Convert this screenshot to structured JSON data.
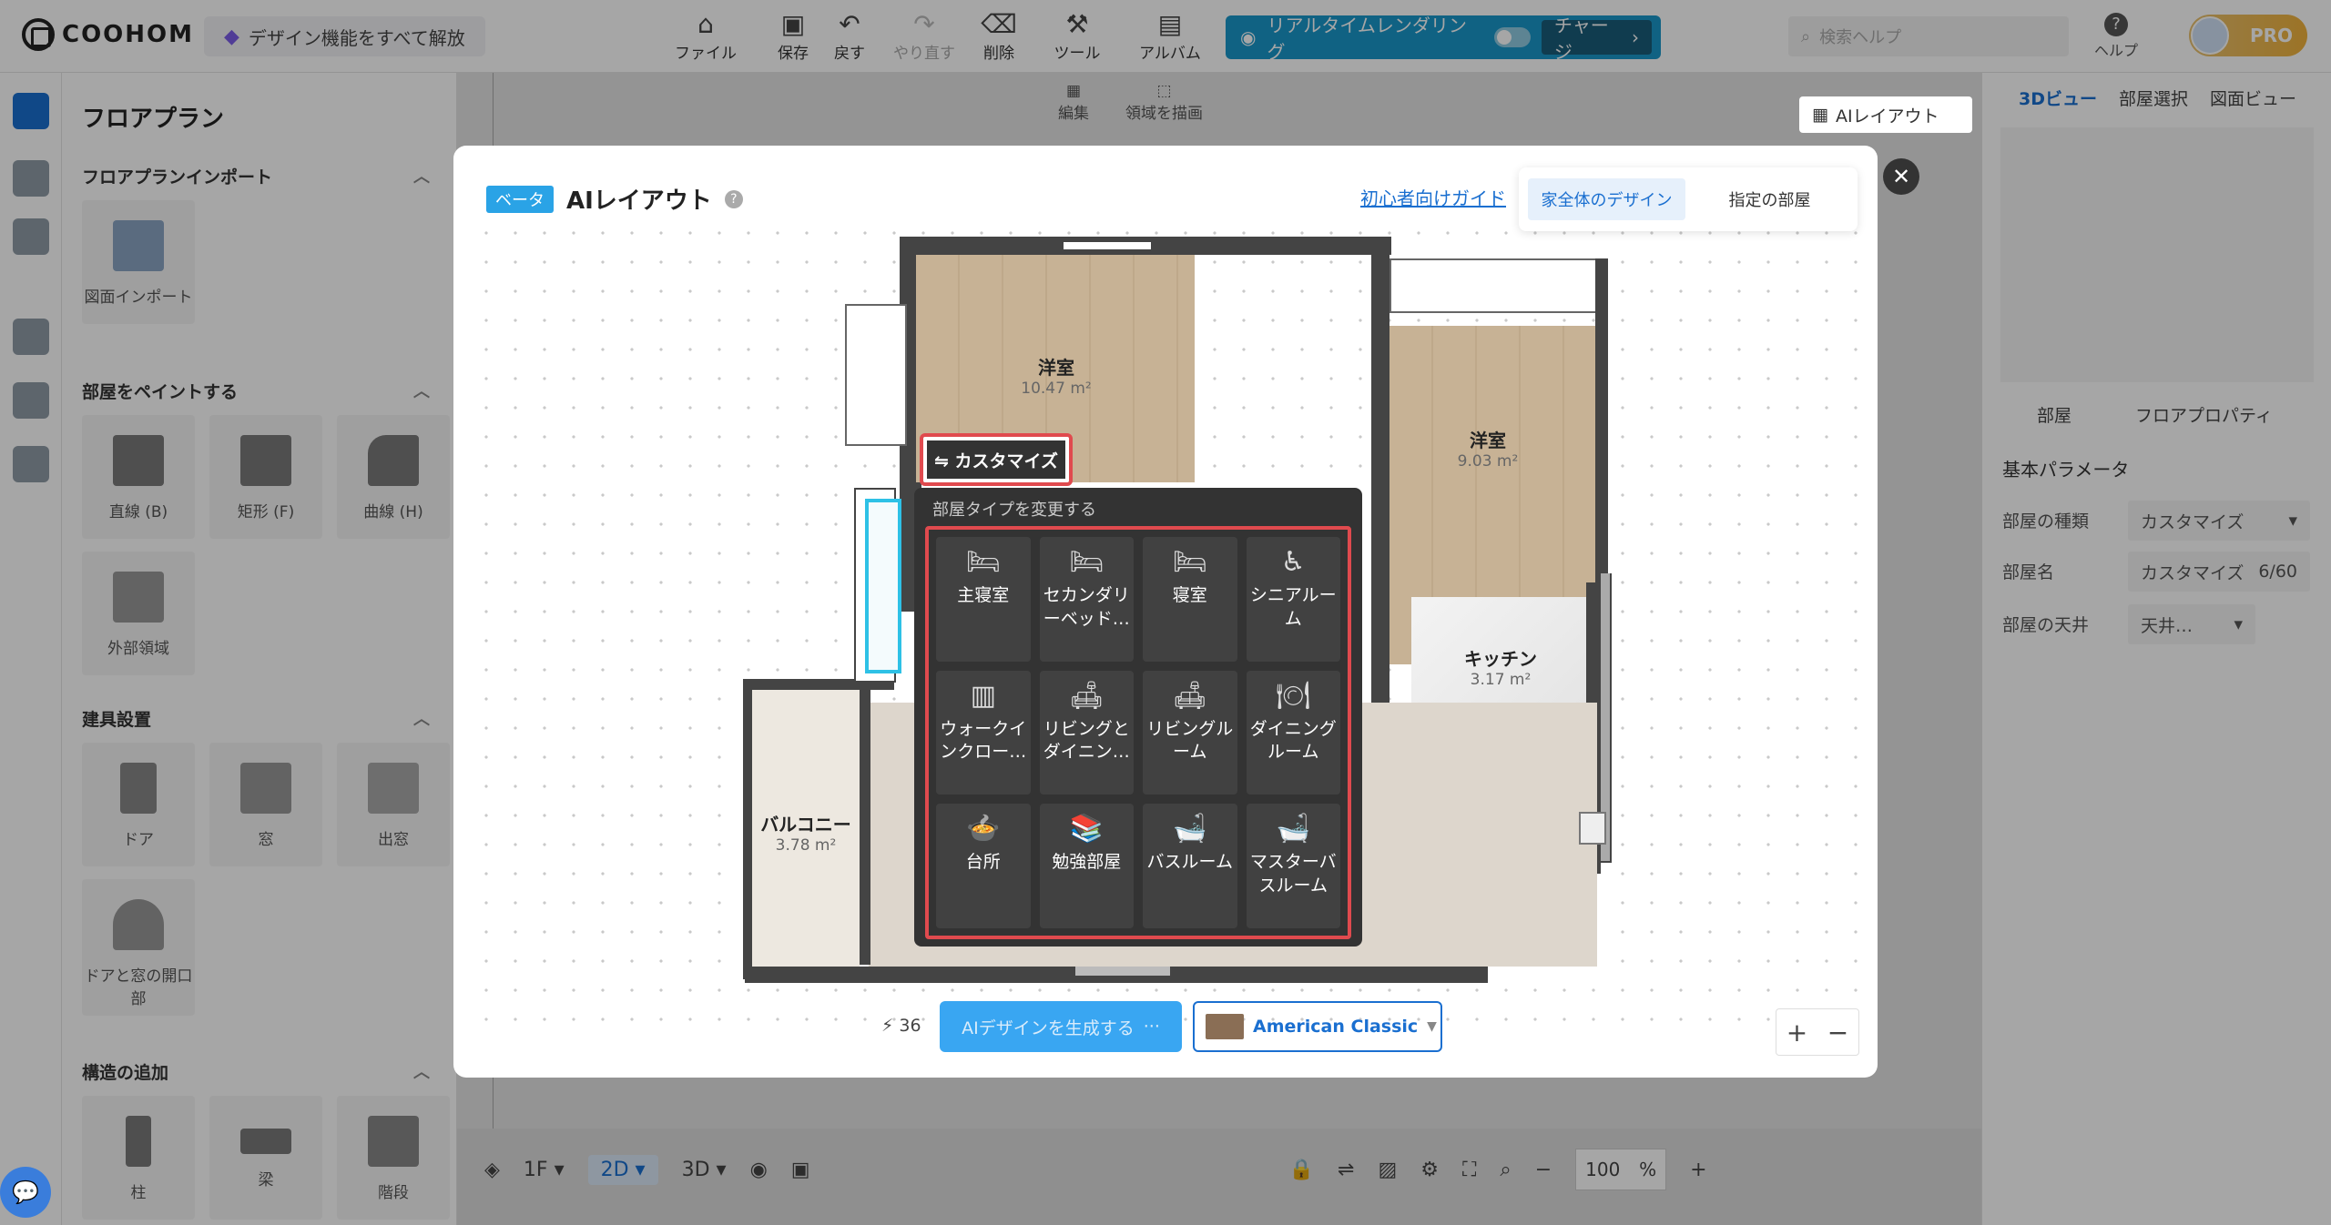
{
  "app": {
    "logo": "COOHOM",
    "unlock": "デザイン機能をすべて解放"
  },
  "toolbar": [
    {
      "icon": "⌂",
      "label": "ファイル",
      "dim": false
    },
    {
      "icon": "▣",
      "label": "保存",
      "dim": false
    },
    {
      "icon": "↶",
      "label": "戻す",
      "dim": false
    },
    {
      "icon": "↷",
      "label": "やり直す",
      "dim": true
    },
    {
      "icon": "⌫",
      "label": "削除",
      "dim": false
    },
    {
      "icon": "⚒",
      "label": "ツール",
      "dim": false
    },
    {
      "icon": "▤",
      "label": "アルバム",
      "dim": false
    }
  ],
  "render": {
    "label": "リアルタイムレンダリング",
    "charge": "チャージ"
  },
  "search": {
    "placeholder": "検索ヘルプ"
  },
  "help": {
    "label": "ヘルプ"
  },
  "pro": "PRO",
  "left": {
    "title": "フロアプラン",
    "sections": {
      "import": "フロアプランインポート",
      "paint": "部屋をペイントする",
      "fixtures": "建具設置",
      "structure": "構造の追加"
    },
    "import_tile": "図面インポート",
    "paint_tiles": [
      "直線 (B)",
      "矩形 (F)",
      "曲線 (H)",
      "外部領域"
    ],
    "fixture_tiles": [
      "ドア",
      "窓",
      "出窓",
      "ドアと窓の開口部"
    ],
    "structure_tiles": [
      "柱",
      "梁",
      "階段"
    ]
  },
  "canvas": {
    "subtools": [
      "編集",
      "領域を描画"
    ],
    "floor": "1F",
    "view2d": "2D",
    "view3d": "3D",
    "zoom": "100",
    "unit": "%"
  },
  "right": {
    "tabs": [
      "3Dビュー",
      "部屋選択",
      "図面ビュー"
    ],
    "ai_button": "AIレイアウト",
    "prop_tabs": [
      "部屋",
      "フロアプロパティ"
    ],
    "basic": "基本パラメータ",
    "fields": [
      {
        "label": "部屋の種類",
        "value": "カスタマイズ"
      },
      {
        "label": "部屋名",
        "value": "カスタマイズ",
        "count": "6/60"
      },
      {
        "label": "部屋の天井",
        "value": "天井…"
      }
    ]
  },
  "modal": {
    "beta": "ベータ",
    "title": "AIレイアウト",
    "guide": "初心者向けガイド",
    "segments": [
      "家全体のデザイン",
      "指定の部屋"
    ],
    "rooms": [
      {
        "name": "洋室",
        "area": "10.47 m²"
      },
      {
        "name": "洋室",
        "area": "9.03 m²"
      },
      {
        "name": "キッチン",
        "area": "3.17 m²"
      },
      {
        "name": "バルコニー",
        "area": "3.78 m²"
      }
    ],
    "customize": "⇋ カスタマイズ",
    "popup_title": "部屋タイプを変更する",
    "room_types": [
      {
        "icon": "🛏",
        "label": "主寝室"
      },
      {
        "icon": "🛏",
        "label": "セカンダリーベッド…"
      },
      {
        "icon": "🛏",
        "label": "寝室"
      },
      {
        "icon": "♿",
        "label": "シニアルーム"
      },
      {
        "icon": "▥",
        "label": "ウォークインクロー…"
      },
      {
        "icon": "🛋",
        "label": "リビングとダイニン…"
      },
      {
        "icon": "🛋",
        "label": "リビングルーム"
      },
      {
        "icon": "🍽",
        "label": "ダイニングルーム"
      },
      {
        "icon": "🍲",
        "label": "台所"
      },
      {
        "icon": "📚",
        "label": "勉強部屋"
      },
      {
        "icon": "🛁",
        "label": "バスルーム"
      },
      {
        "icon": "🛁",
        "label": "マスターバスルーム"
      }
    ],
    "credits": "36",
    "generate": "AIデザインを生成する",
    "style": "American Classic"
  }
}
